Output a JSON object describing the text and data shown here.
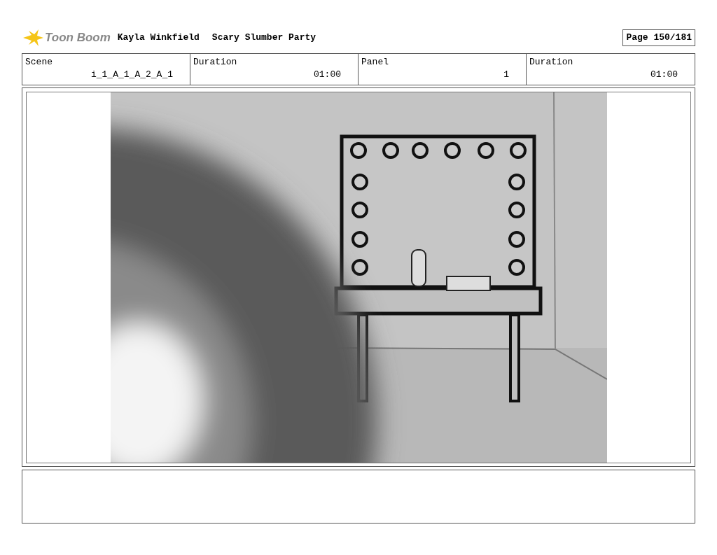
{
  "header": {
    "logo_text": "Toon Boom",
    "author": "Kayla Winkfield",
    "project": "Scary Slumber Party",
    "page": "Page 150/181"
  },
  "info": [
    {
      "label": "Scene",
      "value": "i_1_A_1_A_2_A_1"
    },
    {
      "label": "Duration",
      "value": "01:00"
    },
    {
      "label": "Panel",
      "value": "1"
    },
    {
      "label": "Duration",
      "value": "01:00"
    }
  ]
}
